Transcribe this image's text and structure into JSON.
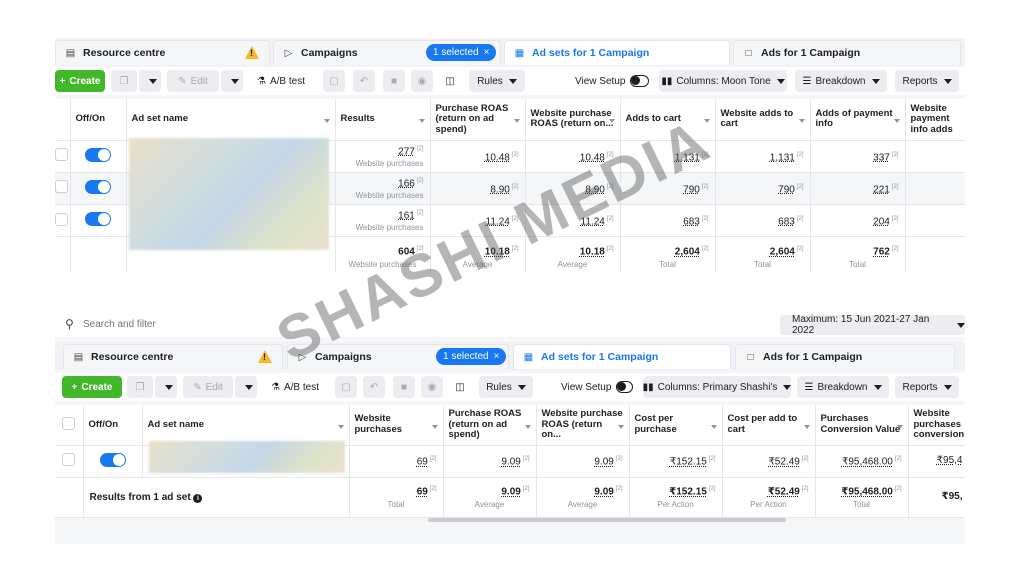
{
  "top": {
    "tabs": {
      "resource": "Resource centre",
      "campaigns": "Campaigns",
      "selected": "1 selected",
      "adsets": "Ad sets for 1 Campaign",
      "ads": "Ads for 1 Campaign"
    },
    "toolbar": {
      "create": "Create",
      "edit": "Edit",
      "ab_test": "A/B test",
      "rules": "Rules",
      "view_setup": "View Setup",
      "columns": "Columns: Moon Tone",
      "breakdown": "Breakdown",
      "reports": "Reports"
    },
    "headers": {
      "off_on": "Off/On",
      "name": "Ad set name",
      "results": "Results",
      "roas": "Purchase ROAS (return on ad spend)",
      "web_roas": "Website purchase ROAS (return on...",
      "adds_cart": "Adds to cart",
      "web_adds_cart": "Website adds to cart",
      "adds_payment": "Adds of payment info",
      "web_payment": "Website payment info adds"
    },
    "rows": [
      {
        "results": "277",
        "results_sub": "Website purchases",
        "roas": "10.48",
        "web_roas": "10.48",
        "adds_cart": "1,131",
        "web_adds_cart": "1,131",
        "adds_payment": "337"
      },
      {
        "results": "166",
        "results_sub": "Website purchases",
        "roas": "8.90",
        "web_roas": "8.90",
        "adds_cart": "790",
        "web_adds_cart": "790",
        "adds_payment": "221"
      },
      {
        "results": "161",
        "results_sub": "Website purchases",
        "roas": "11.24",
        "web_roas": "11.24",
        "adds_cart": "683",
        "web_adds_cart": "683",
        "adds_payment": "204"
      }
    ],
    "totals": {
      "results": "604",
      "results_sub": "Website purchases",
      "roas": "10.18",
      "roas_sub": "Average",
      "web_roas": "10.18",
      "web_roas_sub": "Average",
      "adds_cart": "2,604",
      "adds_cart_sub": "Total",
      "web_adds_cart": "2,604",
      "web_adds_cart_sub": "Total",
      "adds_payment": "762",
      "adds_payment_sub": "Total"
    }
  },
  "bottom": {
    "search_placeholder": "Search and filter",
    "date_range": "Maximum: 15 Jun 2021-27 Jan 2022",
    "tabs": {
      "resource": "Resource centre",
      "campaigns": "Campaigns",
      "selected": "1 selected",
      "adsets": "Ad sets for 1 Campaign",
      "ads": "Ads for 1 Campaign"
    },
    "toolbar": {
      "create": "Create",
      "edit": "Edit",
      "ab_test": "A/B test",
      "rules": "Rules",
      "view_setup": "View Setup",
      "columns": "Columns: Primary Shashi's",
      "breakdown": "Breakdown",
      "reports": "Reports"
    },
    "headers": {
      "off_on": "Off/On",
      "name": "Ad set name",
      "web_purchases": "Website purchases",
      "roas": "Purchase ROAS (return on ad spend)",
      "web_roas": "Website purchase ROAS (return on...",
      "cost_purchase": "Cost per purchase",
      "cost_cart": "Cost per add to cart",
      "conv_value": "Purchases Conversion Value",
      "web_conv": "Website purchases conversion"
    },
    "row": {
      "web_purchases": "69",
      "roas": "9.09",
      "web_roas": "9.09",
      "cost_purchase": "₹152.15",
      "cost_cart": "₹52.49",
      "conv_value": "₹95,468.00",
      "web_conv": "₹95,4"
    },
    "totals": {
      "label": "Results from 1 ad set",
      "web_purchases": "69",
      "web_purchases_sub": "Total",
      "roas": "9.09",
      "roas_sub": "Average",
      "web_roas": "9.09",
      "web_roas_sub": "Average",
      "cost_purchase": "₹152.15",
      "cost_purchase_sub": "Per Action",
      "cost_cart": "₹52.49",
      "cost_cart_sub": "Per Action",
      "conv_value": "₹95,468.00",
      "conv_value_sub": "Total",
      "web_conv": "₹95,"
    }
  },
  "watermark": "SHASHI MEDIA"
}
